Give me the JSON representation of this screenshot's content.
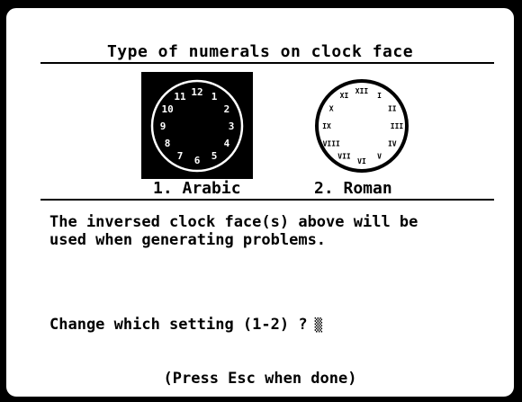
{
  "title": "Type of numerals on clock face",
  "options": [
    {
      "label": "1. Arabic"
    },
    {
      "label": "2. Roman"
    }
  ],
  "arabic_numerals": [
    "12",
    "1",
    "2",
    "3",
    "4",
    "5",
    "6",
    "7",
    "8",
    "9",
    "10",
    "11"
  ],
  "roman_numerals": [
    "XII",
    "I",
    "II",
    "III",
    "IV",
    "V",
    "VI",
    "VII",
    "VIII",
    "IX",
    "X",
    "XI"
  ],
  "message_line1": "The inversed clock face(s) above will be",
  "message_line2": "used when generating problems.",
  "prompt": "Change which setting (1-2) ?",
  "cursor_glyph": "▒",
  "footer": "(Press Esc when done)",
  "colors": {
    "foreground": "#000000",
    "background": "#ffffff"
  }
}
